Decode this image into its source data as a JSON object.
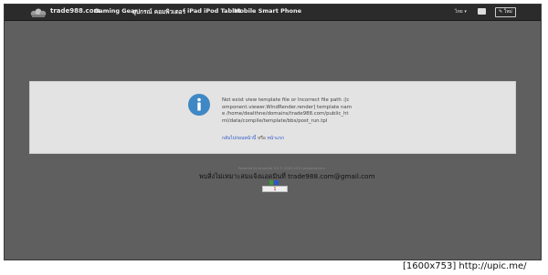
{
  "header": {
    "brand": "trade988.com",
    "nav": [
      "Gaming Gear",
      "อุปกรณ์ คอมพิวเตอร์",
      "iPad iPod Tablet",
      "Mobile Smart Phone"
    ],
    "lang_label": "ไทย ▾",
    "write_label": "✎ ใหม่"
  },
  "message": {
    "text": "Not exist view template file or Incorrect file path :[component.viewer.WindRender.render] template name /home/dealthne/domains/trade988.com/public_html/data/compile/template/bbs/post_run.tpl",
    "back_link": "กลับไปก่อนหน้านี้",
    "or_text": "หรือ",
    "home_link": "หน้าแรก"
  },
  "footer": {
    "powered": "Powered by phpwind 9.0 © 2003-2015 phpwind.com",
    "contact": "พบสิ่งไม่เหมาะสมแจ้งแอดมินที่ trade988.com@gmail.com",
    "counter": "1"
  },
  "watermark": "[1600x753] http://upic.me/",
  "colors": {
    "background": "#5f5f5f",
    "navbar": "#2b2b2b",
    "box": "#e3e3e3",
    "info": "#3f88c5",
    "link": "#2f55c8"
  }
}
